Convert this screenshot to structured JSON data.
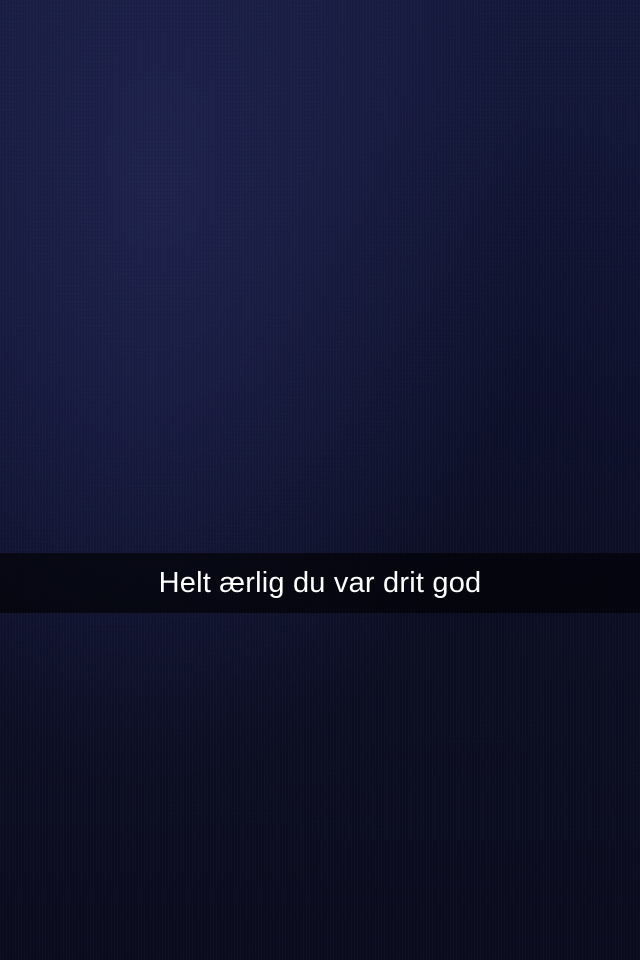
{
  "snap": {
    "caption": "Helt ærlig du var drit god"
  },
  "colors": {
    "background": "#0f1230",
    "caption_bar": "#000000",
    "caption_text": "#ffffff"
  }
}
